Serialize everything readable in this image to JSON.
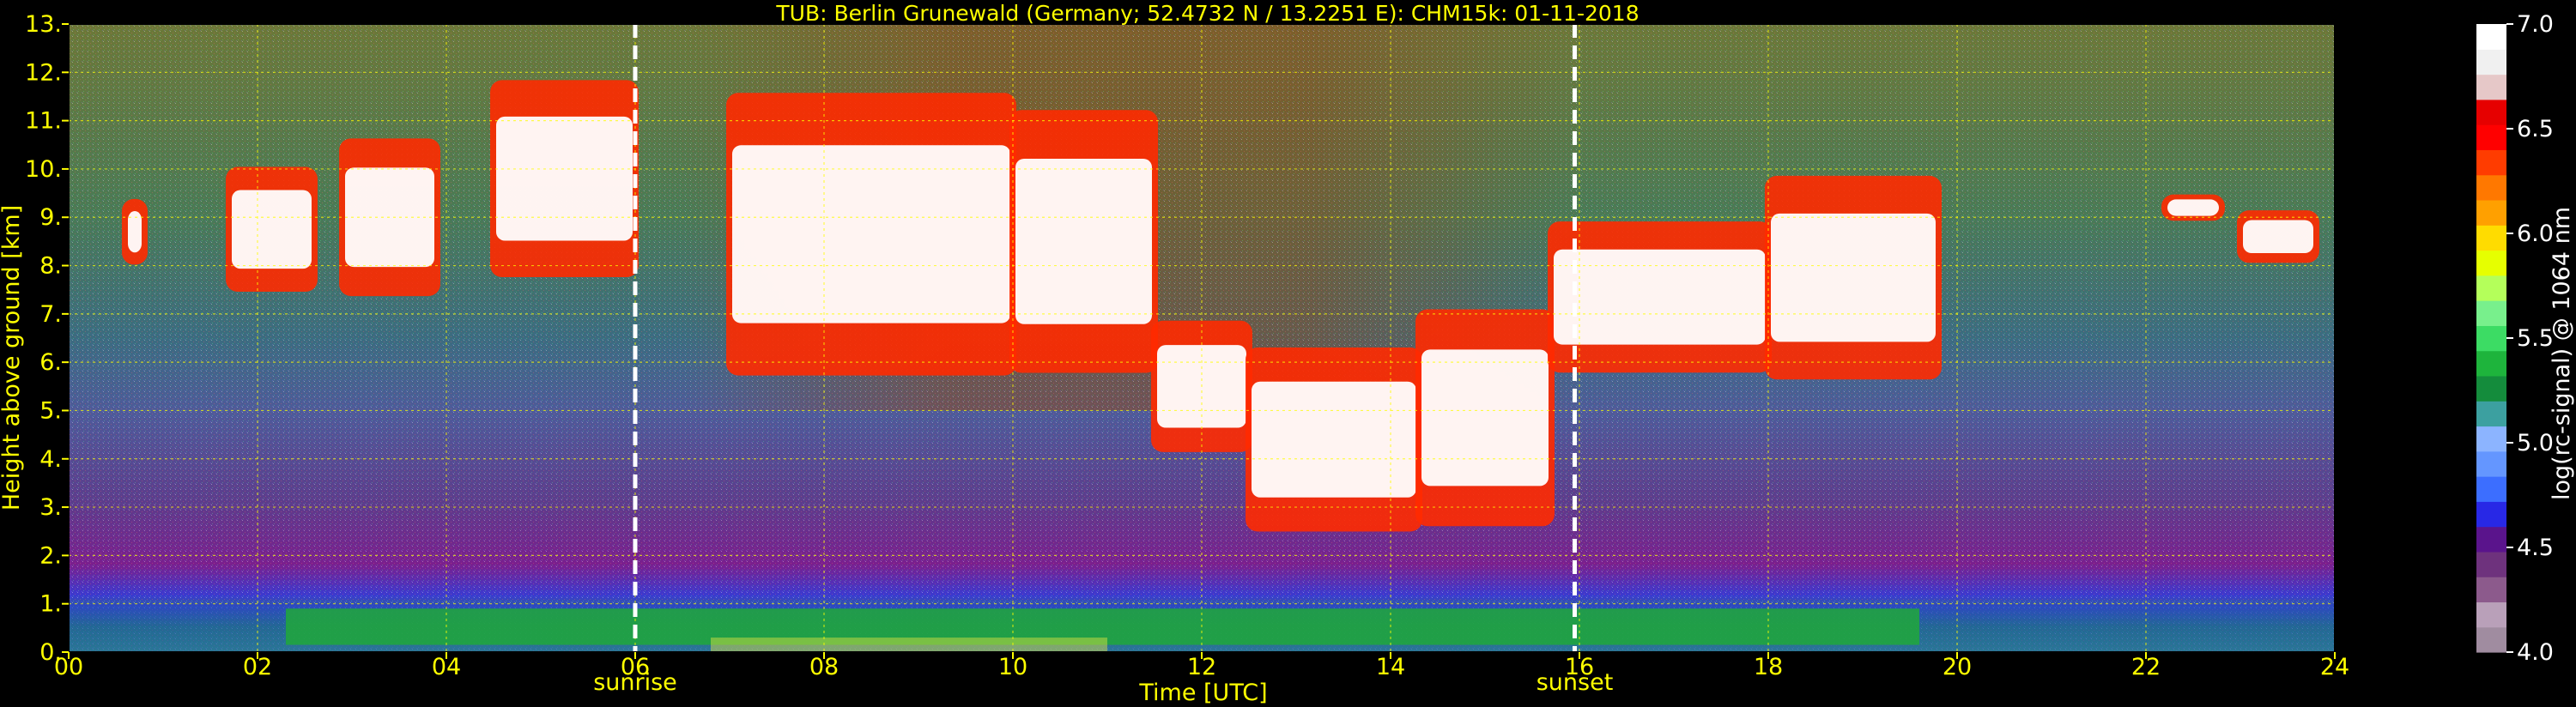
{
  "chart_data": {
    "type": "heatmap",
    "title": "TUB: Berlin Grunewald (Germany; 52.4732 N / 13.2251 E):    CHM15k: 01-11-2018",
    "xlabel": "Time [UTC]",
    "ylabel": "Height above ground [km]",
    "xlim": [
      0,
      24
    ],
    "ylim": [
      0,
      13
    ],
    "x_ticks": [
      0,
      2,
      4,
      6,
      8,
      10,
      12,
      14,
      16,
      18,
      20,
      22,
      24
    ],
    "x_tick_labels": [
      "00",
      "02",
      "04",
      "06",
      "08",
      "10",
      "12",
      "14",
      "16",
      "18",
      "20",
      "22",
      "24"
    ],
    "y_ticks": [
      0,
      1,
      2,
      3,
      4,
      5,
      6,
      7,
      8,
      9,
      10,
      11,
      12,
      13
    ],
    "y_tick_labels": [
      "0.",
      "1.",
      "2.",
      "3.",
      "4.",
      "5.",
      "6.",
      "7.",
      "8.",
      "9.",
      "10.",
      "11.",
      "12.",
      "13."
    ],
    "grid": true,
    "markers": [
      {
        "time": 6.0,
        "label": "sunrise"
      },
      {
        "time": 15.95,
        "label": "sunset"
      }
    ],
    "colorbar": {
      "label": "log(rc-signal) @ 1064 nm",
      "range": [
        4.0,
        7.0
      ],
      "ticks": [
        4.0,
        4.5,
        5.0,
        5.5,
        6.0,
        6.5,
        7.0
      ],
      "tick_labels": [
        "4.0",
        "4.5",
        "5.0",
        "5.5",
        "6.0",
        "6.5",
        "7.0"
      ],
      "colors": [
        "#a08ca0",
        "#b9a0b9",
        "#8c5a8c",
        "#6e327d",
        "#5a148c",
        "#2828e6",
        "#3c6eff",
        "#6496ff",
        "#8cb4ff",
        "#3ca0a0",
        "#148c3c",
        "#1eb43c",
        "#3cdc64",
        "#78f08c",
        "#b4ff5a",
        "#e6ff00",
        "#ffdc00",
        "#ffa000",
        "#ff7800",
        "#ff3c00",
        "#ff0000",
        "#e60000",
        "#e6c8c8",
        "#f0f0f0",
        "#ffffff"
      ]
    },
    "cloud_layers": [
      {
        "start": 0.6,
        "end": 0.8,
        "base_km": 8.2,
        "top_km": 9.2
      },
      {
        "start": 1.7,
        "end": 2.6,
        "base_km": 7.8,
        "top_km": 9.7
      },
      {
        "start": 2.9,
        "end": 3.9,
        "base_km": 7.8,
        "top_km": 10.2
      },
      {
        "start": 4.5,
        "end": 6.0,
        "base_km": 8.3,
        "top_km": 11.3
      },
      {
        "start": 7.0,
        "end": 10.0,
        "base_km": 6.5,
        "top_km": 10.8
      },
      {
        "start": 10.0,
        "end": 11.5,
        "base_km": 6.5,
        "top_km": 10.5
      },
      {
        "start": 11.5,
        "end": 12.5,
        "base_km": 4.5,
        "top_km": 6.5
      },
      {
        "start": 12.5,
        "end": 14.3,
        "base_km": 3.0,
        "top_km": 5.8
      },
      {
        "start": 14.3,
        "end": 15.7,
        "base_km": 3.2,
        "top_km": 6.5
      },
      {
        "start": 15.7,
        "end": 18.0,
        "base_km": 6.2,
        "top_km": 8.5
      },
      {
        "start": 18.0,
        "end": 19.8,
        "base_km": 6.2,
        "top_km": 9.3
      },
      {
        "start": 22.2,
        "end": 22.8,
        "base_km": 9.0,
        "top_km": 9.4
      },
      {
        "start": 23.0,
        "end": 23.8,
        "base_km": 8.2,
        "top_km": 9.0
      }
    ]
  }
}
